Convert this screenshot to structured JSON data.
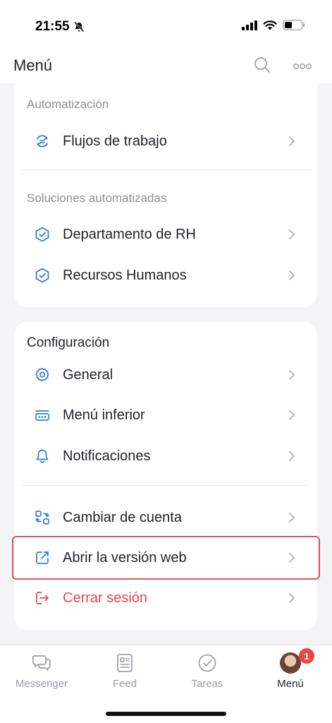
{
  "status_bar": {
    "time": "21:55"
  },
  "header": {
    "title": "Menú",
    "icons": [
      "search-icon",
      "more-icon"
    ]
  },
  "automation": {
    "section_label": "Automatización",
    "items": [
      {
        "label": "Flujos de trabajo",
        "icon": "workflow-icon"
      }
    ]
  },
  "automated_solutions": {
    "section_label": "Soluciones automatizadas",
    "items": [
      {
        "label": "Departamento de RH",
        "icon": "hexagon-check-icon"
      },
      {
        "label": "Recursos Humanos",
        "icon": "hexagon-check-icon"
      }
    ]
  },
  "settings": {
    "section_title": "Configuración",
    "items": [
      {
        "label": "General",
        "icon": "gear-icon"
      },
      {
        "label": "Menú inferior",
        "icon": "bottom-menu-icon"
      },
      {
        "label": "Notificaciones",
        "icon": "bell-icon"
      }
    ]
  },
  "account": {
    "items": [
      {
        "label": "Cambiar de cuenta",
        "icon": "switch-account-icon"
      },
      {
        "label": "Abrir la versión web",
        "icon": "external-link-icon"
      },
      {
        "label": "Cerrar sesión",
        "icon": "logout-icon"
      }
    ]
  },
  "tabbar": {
    "tabs": [
      {
        "label": "Messenger",
        "icon": "chat-icon"
      },
      {
        "label": "Feed",
        "icon": "feed-icon"
      },
      {
        "label": "Tareas",
        "icon": "check-circle-icon"
      },
      {
        "label": "Menú",
        "icon": "avatar"
      }
    ],
    "badge": "1"
  },
  "colors": {
    "accent": "#2f7ee0",
    "danger": "#e5484d",
    "highlight_border": "#d9555a",
    "background": "#f3f4f6"
  }
}
